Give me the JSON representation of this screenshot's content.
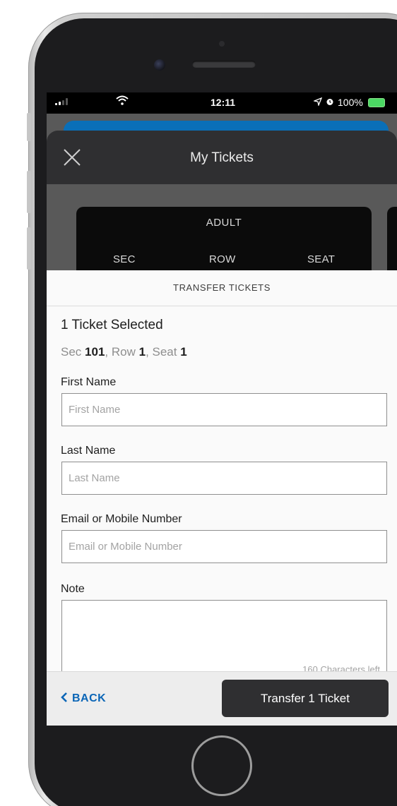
{
  "status_bar": {
    "time": "12:11",
    "battery": "100%",
    "wifi_icon": "wifi-icon",
    "location_icon": "location-arrow-icon",
    "alarm_icon": "alarm-icon"
  },
  "header": {
    "title": "My Tickets",
    "close_icon": "close-icon"
  },
  "ticket_card": {
    "type": "ADULT",
    "columns": [
      "SEC",
      "ROW",
      "SEAT"
    ]
  },
  "transfer": {
    "title": "TRANSFER TICKETS",
    "selected_count": "1 Ticket Selected",
    "seat": {
      "sec_label": "Sec ",
      "sec_value": "101",
      "row_label": ", Row ",
      "row_value": "1",
      "seat_label": ", Seat ",
      "seat_value": "1"
    },
    "first_name": {
      "label": "First Name",
      "placeholder": "First Name",
      "value": ""
    },
    "last_name": {
      "label": "Last Name",
      "placeholder": "Last Name",
      "value": ""
    },
    "contact": {
      "label": "Email or Mobile Number",
      "placeholder": "Email or Mobile Number",
      "value": ""
    },
    "note": {
      "label": "Note",
      "value": "",
      "chars_left": "160 Characters left"
    }
  },
  "footer": {
    "back_label": "BACK",
    "back_icon": "chevron-left-icon",
    "transfer_label": "Transfer 1 Ticket"
  },
  "colors": {
    "accent_blue": "#0b66b7",
    "dark_header": "#2f2f31",
    "button_dark": "#2f2f31",
    "battery_green": "#4cd964"
  }
}
